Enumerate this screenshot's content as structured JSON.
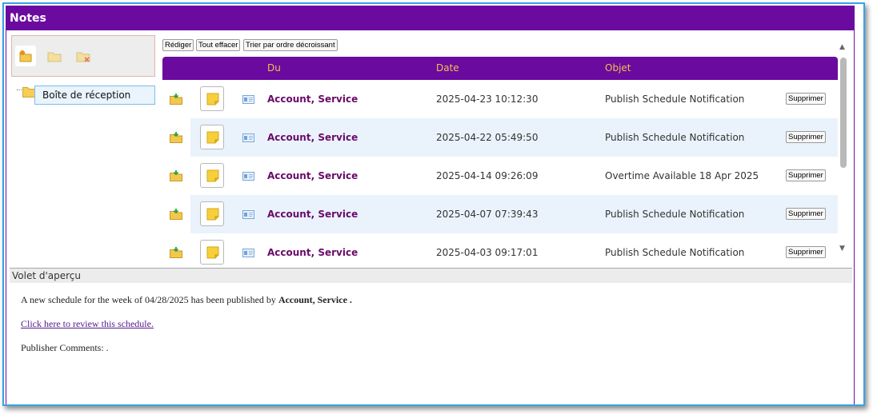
{
  "title": "Notes",
  "folder_toolbar": {
    "icons": [
      "new-folder-icon",
      "folder-icon",
      "delete-folder-icon"
    ]
  },
  "tree": {
    "items": [
      {
        "label": "Boîte de réception",
        "selected": true
      }
    ]
  },
  "actions": {
    "compose": "Rédiger",
    "clear_all": "Tout effacer",
    "sort_desc": "Trier par ordre décroissant"
  },
  "table": {
    "headers": {
      "from": "Du",
      "date": "Date",
      "subject": "Objet"
    },
    "rows": [
      {
        "from": "Account, Service",
        "date": "2025-04-23 10:12:30",
        "subject": "Publish Schedule Notification",
        "delete": "Supprimer"
      },
      {
        "from": "Account, Service",
        "date": "2025-04-22 05:49:50",
        "subject": "Publish Schedule Notification",
        "delete": "Supprimer"
      },
      {
        "from": "Account, Service",
        "date": "2025-04-14 09:26:09",
        "subject": "Overtime Available 18 Apr 2025",
        "delete": "Supprimer"
      },
      {
        "from": "Account, Service",
        "date": "2025-04-07 07:39:43",
        "subject": "Publish Schedule Notification",
        "delete": "Supprimer"
      },
      {
        "from": "Account, Service",
        "date": "2025-04-03 09:17:01",
        "subject": "Publish Schedule Notification",
        "delete": "Supprimer"
      }
    ]
  },
  "preview": {
    "heading": "Volet d'aperçu",
    "line1_prefix": "A new schedule for the week of 04/28/2025 has been published by",
    "line1_sender": "Account, Service .",
    "link": "Click here to review this schedule.",
    "comments": "Publisher Comments: ."
  },
  "colors": {
    "header_bg": "#6a0a9f",
    "header_text": "#f5c04a",
    "sender_text": "#6a0a6a",
    "row_alt_bg": "#eaf3fb",
    "frame_border": "#36a3e6"
  }
}
